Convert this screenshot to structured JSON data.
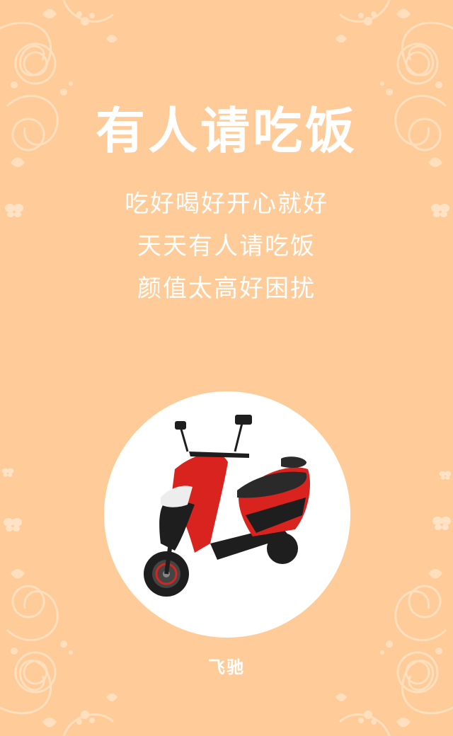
{
  "poster": {
    "title": "有人请吃饭",
    "lines": [
      "吃好喝好开心就好",
      "天天有人请吃饭",
      "颜值太高好困扰"
    ],
    "brand": "飞驰"
  },
  "colors": {
    "background": "#FFCC99",
    "ornament": "#FFE3C4",
    "text": "#FFFFFF",
    "scooter_body": "#D8231F",
    "scooter_dark": "#1E1E1E"
  },
  "icons": [
    "floral-ornament-icon",
    "butterfly-icon",
    "scooter-image"
  ]
}
